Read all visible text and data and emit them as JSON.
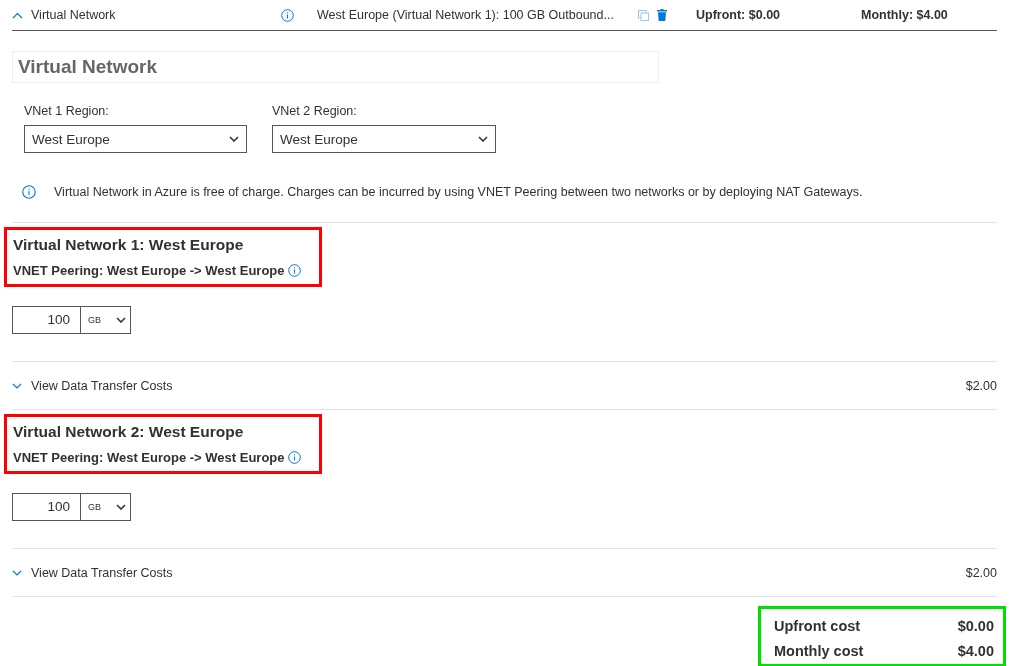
{
  "header": {
    "expanded": true,
    "title": "Virtual Network",
    "summary": "West Europe (Virtual Network 1): 100 GB Outbound...",
    "upfront": "Upfront: $0.00",
    "monthly": "Monthly: $4.00"
  },
  "card_title": "Virtual Network",
  "regions": [
    {
      "label": "VNet 1 Region:",
      "value": "West Europe"
    },
    {
      "label": "VNet 2 Region:",
      "value": "West Europe"
    }
  ],
  "info": "Virtual Network in Azure is free of charge. Charges can be incurred by using VNET Peering between two networks or by deploying NAT Gateways.",
  "networks": [
    {
      "title": "Virtual Network 1: West Europe",
      "subtitle": "VNET Peering: West Europe -> West Europe",
      "highlighted": true,
      "amount": "100",
      "unit": "GB",
      "costs_label": "View Data Transfer Costs",
      "costs_expanded": false,
      "cost": "$2.00"
    },
    {
      "title": "Virtual Network 2: West Europe",
      "subtitle": "VNET Peering: West Europe -> West Europe",
      "highlighted": true,
      "amount": "100",
      "unit": "GB",
      "costs_label": "View Data Transfer Costs",
      "costs_expanded": false,
      "cost": "$2.00"
    }
  ],
  "totals": {
    "highlighted": true,
    "rows": [
      {
        "label": "Upfront cost",
        "value": "$0.00"
      },
      {
        "label": "Monthly cost",
        "value": "$4.00"
      }
    ]
  }
}
